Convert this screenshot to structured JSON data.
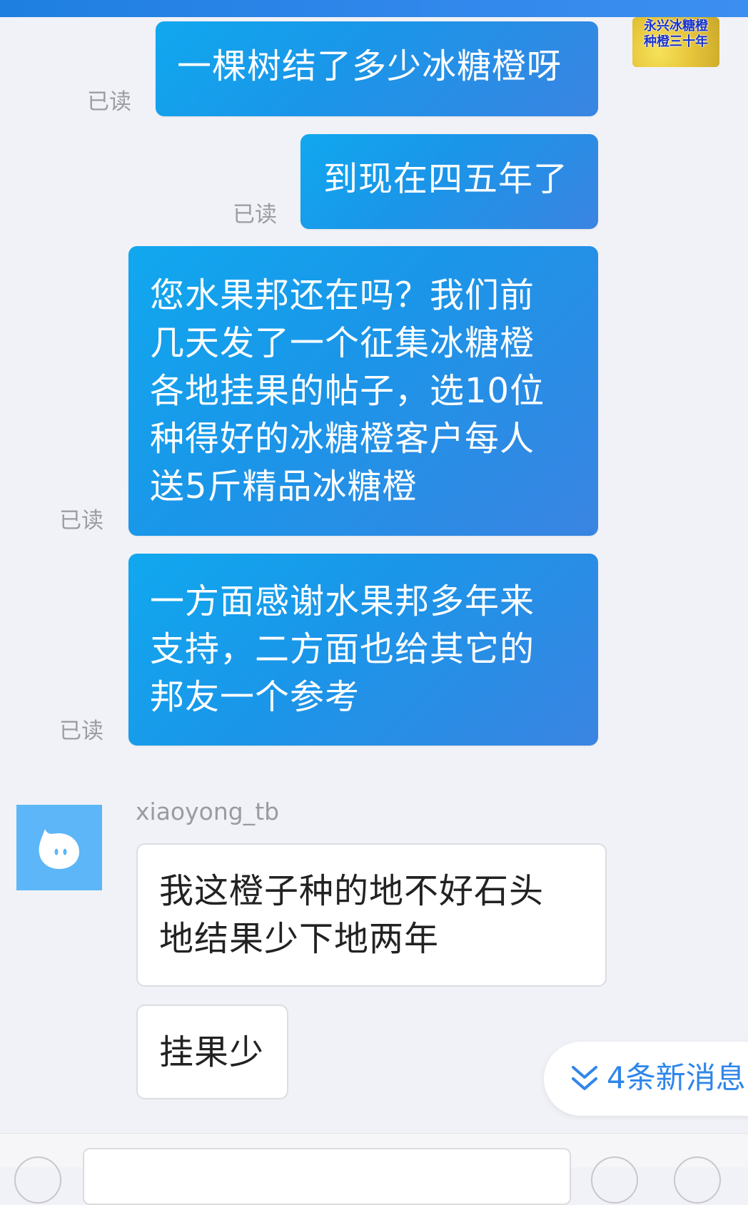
{
  "self_avatar": {
    "line1": "永兴冰糖橙",
    "line2": "种橙三十年"
  },
  "messages": [
    {
      "text": "一棵树结了多少冰糖橙呀",
      "status": "已读"
    },
    {
      "text": "到现在四五年了",
      "status": "已读"
    },
    {
      "lines": [
        "您水果邦还在吗？我们前",
        "几天发了一个征集冰糖橙",
        "各地挂果的帖子，选10位",
        "种得好的冰糖橙客户每人",
        "送5斤精品冰糖橙"
      ],
      "status": "已读"
    },
    {
      "lines": [
        "一方面感谢水果邦多年来",
        "支持，二方面也给其它的",
        "邦友一个参考"
      ],
      "status": "已读"
    }
  ],
  "peer": {
    "name": "xiaoyong_tb",
    "messages": [
      {
        "lines": [
          "我这橙子种的地不好石头",
          "地结果少下地两年"
        ]
      },
      {
        "text": "挂果少"
      }
    ]
  },
  "new_messages": {
    "label": "4条新消息",
    "icon": "double-chevron-down-icon"
  },
  "colors": {
    "outgoing_bubble": "#1b95e8",
    "accent": "#2f86ea",
    "background": "#f1f2f7"
  }
}
